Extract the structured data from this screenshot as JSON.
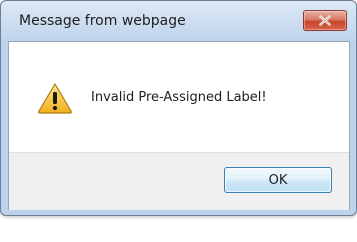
{
  "dialog": {
    "title": "Message from webpage",
    "message": "Invalid Pre-Assigned Label!",
    "ok_label": "OK",
    "icon": "warning-icon",
    "close_icon": "close-icon"
  },
  "colors": {
    "close_button": "#c8462c",
    "warning_fill": "#f2c12e",
    "ok_border": "#3c7fb1"
  }
}
